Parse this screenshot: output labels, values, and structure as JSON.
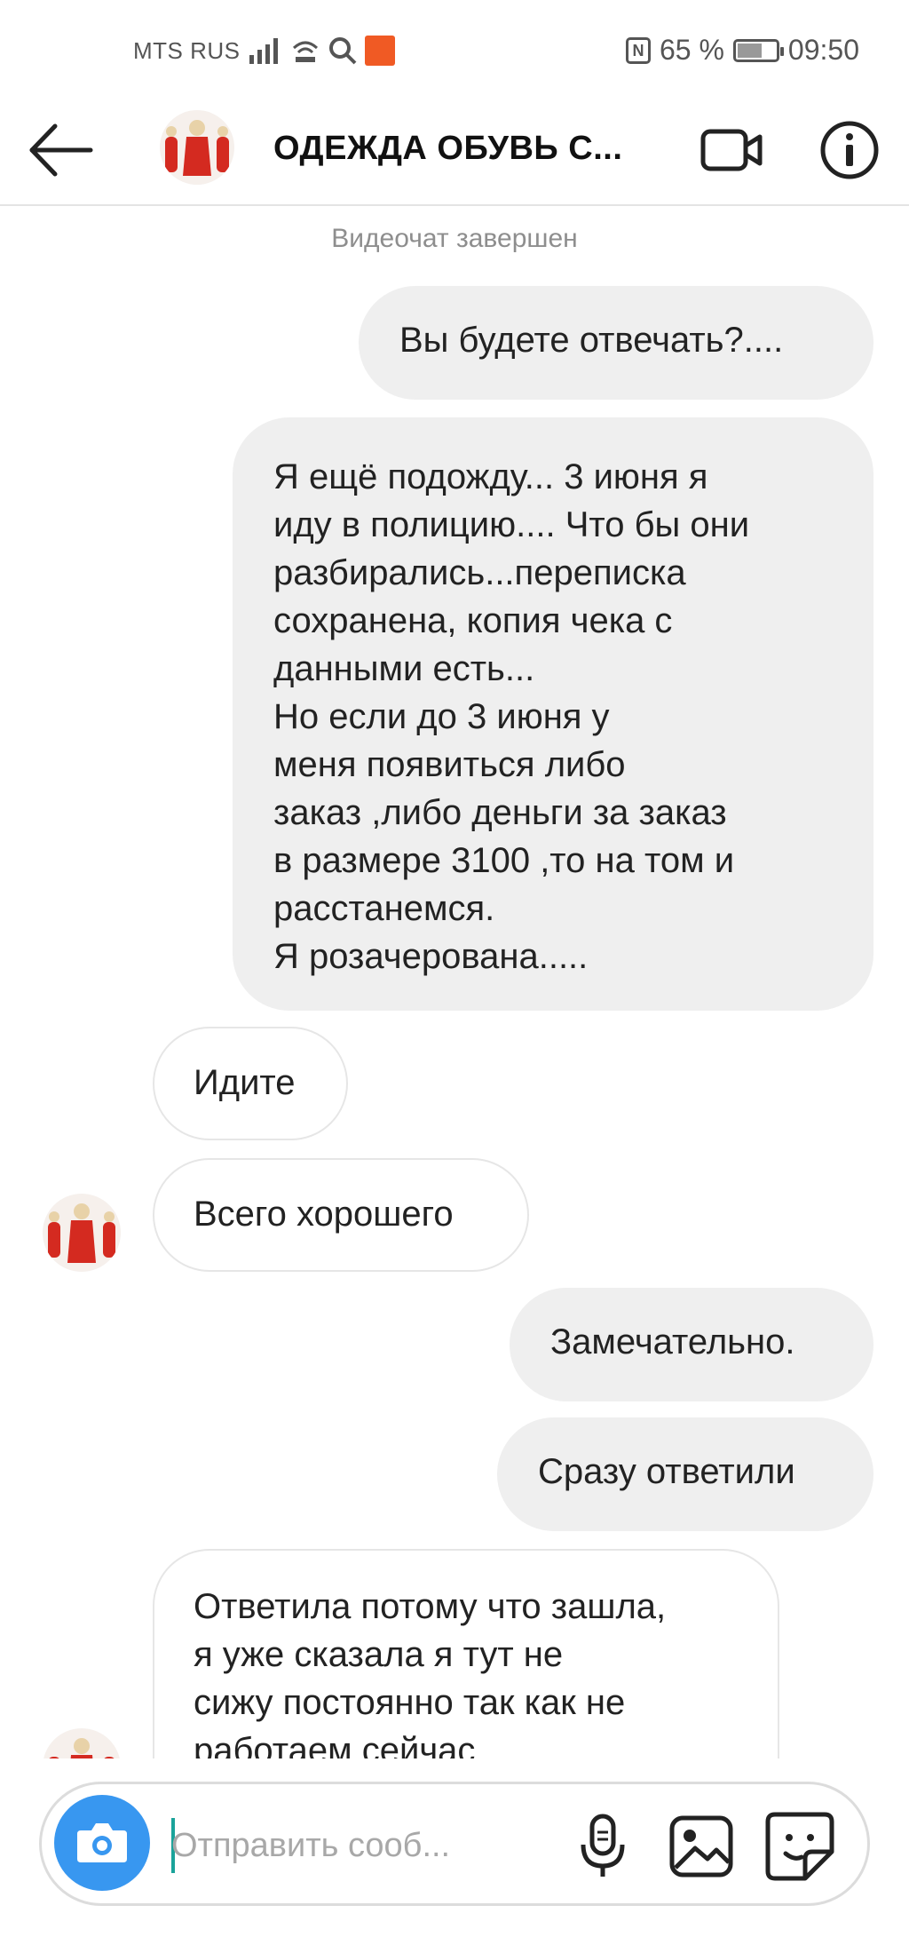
{
  "status_bar": {
    "carrier": "MTS RUS",
    "battery_pct": "65 %",
    "battery_level": 0.65,
    "time": "09:50",
    "icons": [
      "signal-icon",
      "wifi-calling-icon",
      "search-icon",
      "aliexpress-icon",
      "nfc-icon",
      "battery-icon"
    ]
  },
  "header": {
    "title": "ОДЕЖДА ОБУВЬ С...",
    "icons": [
      "back-arrow-icon",
      "video-call-icon",
      "info-icon"
    ]
  },
  "thread": {
    "system_note": "Видеочат завершен",
    "messages": [
      {
        "dir": "out",
        "text": "Вы будете отвечать?...."
      },
      {
        "dir": "out",
        "lines": [
          "Я ещё подожду... 3 июня я",
          "иду в полицию.... Что бы они",
          "разбирались...переписка",
          "сохранена, копия чека с",
          "данными есть...",
          "Но если до 3 июня у",
          "меня появиться либо",
          "заказ ,либо деньги за заказ",
          "в размере 3100 ,то на том и",
          "расстанемся.",
          "Я розачерована....."
        ]
      },
      {
        "dir": "in",
        "text": "Идите"
      },
      {
        "dir": "in",
        "text": "Всего хорошего"
      },
      {
        "dir": "out",
        "text": "Замечательно."
      },
      {
        "dir": "out",
        "text": "Сразу ответили"
      },
      {
        "dir": "in",
        "lines": [
          "Ответила потому что зашла,",
          "я уже сказала я тут не",
          "сижу постоянно так как не",
          "работаем сейчас"
        ]
      }
    ]
  },
  "composer": {
    "placeholder": "Отправить сооб...",
    "icons": [
      "camera-icon",
      "microphone-icon",
      "gallery-icon",
      "sticker-icon"
    ]
  },
  "colors": {
    "outgoing_bubble": "#efefef",
    "incoming_border": "#e6e6e6",
    "camera_button": "#3897f0",
    "system_text": "#8e8e8e"
  }
}
